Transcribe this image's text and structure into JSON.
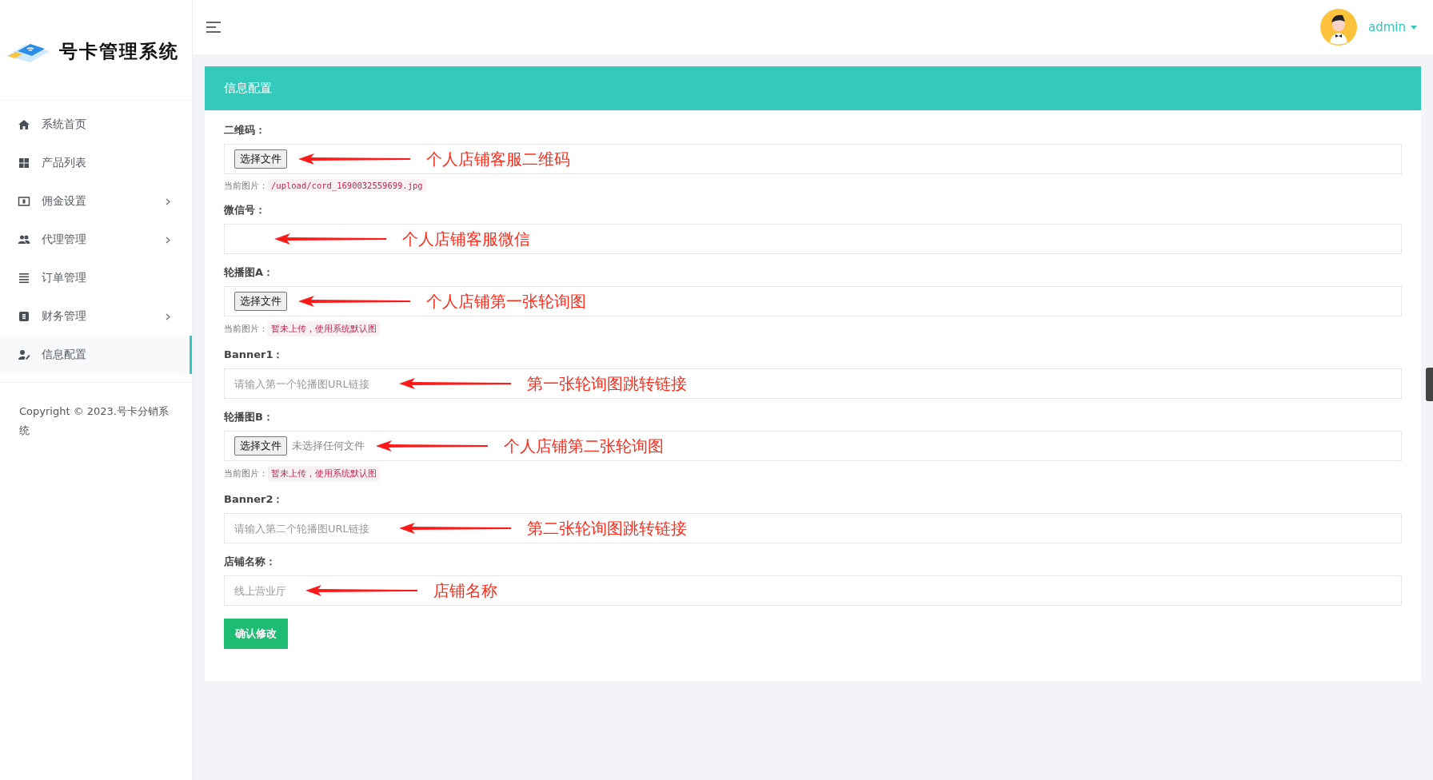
{
  "sidebar": {
    "logo_text": "号卡管理系统",
    "items": [
      {
        "label": "系统首页",
        "has_submenu": false,
        "selected": false
      },
      {
        "label": "产品列表",
        "has_submenu": false,
        "selected": false
      },
      {
        "label": "佣金设置",
        "has_submenu": true,
        "selected": false
      },
      {
        "label": "代理管理",
        "has_submenu": true,
        "selected": false
      },
      {
        "label": "订单管理",
        "has_submenu": false,
        "selected": false
      },
      {
        "label": "财务管理",
        "has_submenu": true,
        "selected": false
      },
      {
        "label": "信息配置",
        "has_submenu": false,
        "selected": true
      }
    ],
    "copyright": "Copyright © 2023.号卡分销系统"
  },
  "header": {
    "user": "admin"
  },
  "panel": {
    "title": "信息配置",
    "fields": [
      {
        "kind": "file",
        "label": "二维码：",
        "button": "选择文件",
        "current_label": "当前图片：",
        "current": "/upload/cord_1690032559699.jpg",
        "code": true,
        "note": "个人店铺客服二维码"
      },
      {
        "kind": "text",
        "label": "微信号：",
        "note": "个人店铺客服微信"
      },
      {
        "kind": "file",
        "label": "轮播图A：",
        "button": "选择文件",
        "current_label": "当前图片：",
        "current": "暂未上传，使用系统默认图",
        "code": false,
        "note": "个人店铺第一张轮询图"
      },
      {
        "kind": "text",
        "label": "Banner1：",
        "placeholder": "请输入第一个轮播图URL链接",
        "note": "第一张轮询图跳转链接"
      },
      {
        "kind": "file",
        "label": "轮播图B：",
        "button": "选择文件",
        "file_status": "未选择任何文件",
        "current_label": "当前图片：",
        "current": "暂未上传，使用系统默认图",
        "code": false,
        "note": "个人店铺第二张轮询图"
      },
      {
        "kind": "text",
        "label": "Banner2：",
        "placeholder": "请输入第二个轮播图URL链接",
        "note": "第二张轮询图跳转链接"
      },
      {
        "kind": "text",
        "label": "店铺名称：",
        "placeholder": "线上营业厅",
        "note": "店铺名称"
      }
    ],
    "submit": "确认修改"
  }
}
